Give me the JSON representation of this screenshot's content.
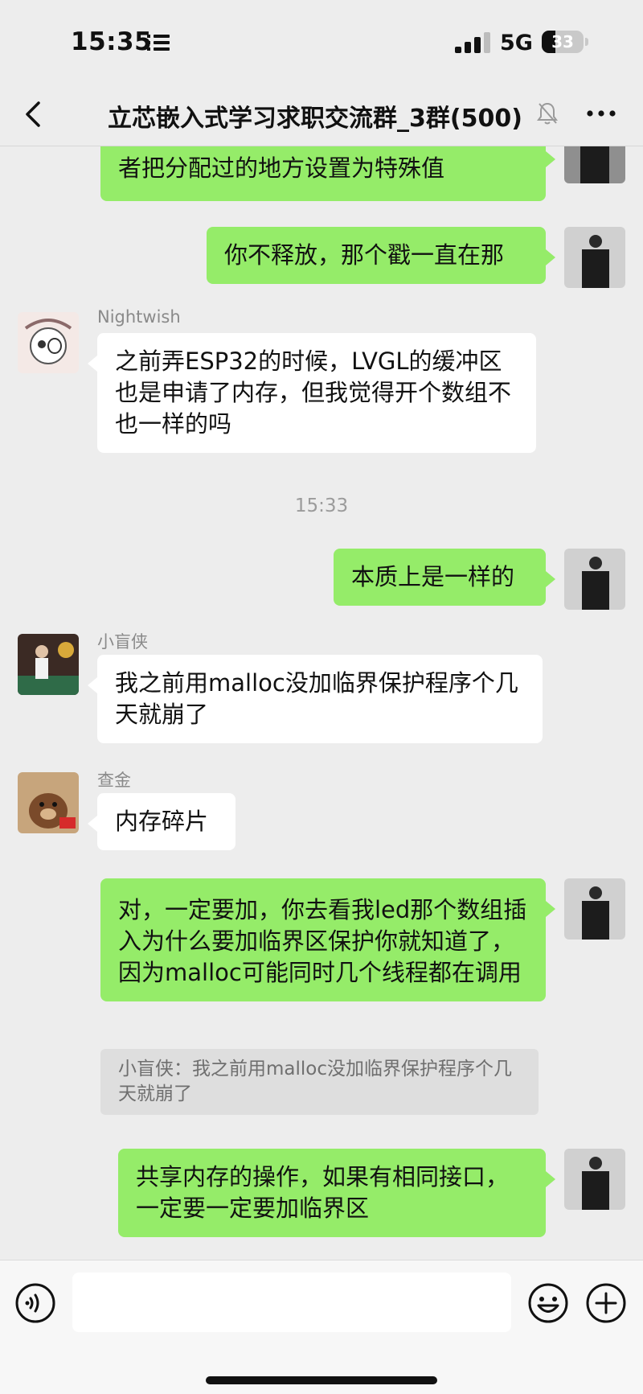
{
  "status_bar": {
    "time": "15:35",
    "network": "5G",
    "battery": "33",
    "battery_level": 0.33
  },
  "nav": {
    "title": "立芯嵌入式学习求职交流群_3群(500)",
    "icons": [
      "back-arrow-icon",
      "mute-bell-icon",
      "more-dots-icon"
    ]
  },
  "messages": [
    {
      "side": "out",
      "text": "者把分配过的地方设置为特殊值"
    },
    {
      "side": "out",
      "text": "你不释放，那个戳一直在那"
    },
    {
      "side": "in",
      "sender": "Nightwish",
      "text": "之前弄ESP32的时候，LVGL的缓冲区也是申请了内存，但我觉得开个数组不也一样的吗"
    },
    {
      "timestamp": "15:33"
    },
    {
      "side": "out",
      "text": "本质上是一样的"
    },
    {
      "side": "in",
      "sender": "小盲侠",
      "text": "我之前用malloc没加临界保护程序个几天就崩了"
    },
    {
      "side": "in",
      "sender": "查金",
      "text": "内存碎片"
    },
    {
      "side": "out",
      "text": "对，一定要加，你去看我led那个数组插入为什么要加临界区保护你就知道了，因为malloc可能同时几个线程都在调用",
      "quote": "小盲侠：我之前用malloc没加临界保护程序个几天就崩了"
    },
    {
      "side": "out",
      "text": "共享内存的操作，如果有相同接口，一定要一定要加临界区"
    }
  ],
  "input_bar": {
    "placeholder": "",
    "icons": [
      "voice-icon",
      "emoji-icon",
      "plus-icon"
    ]
  },
  "colors": {
    "outgoing_bubble": "#95ec69",
    "incoming_bubble": "#ffffff",
    "background": "#ededed"
  }
}
